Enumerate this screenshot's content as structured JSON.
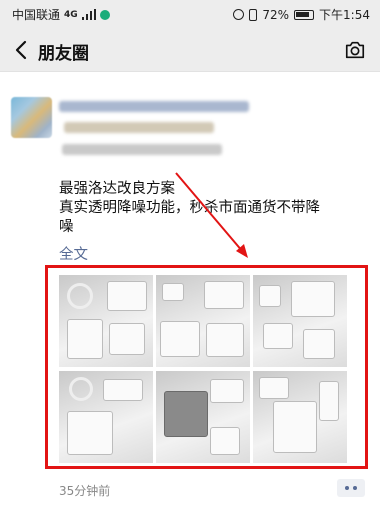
{
  "status_bar": {
    "carrier": "中国联通",
    "network": "4G",
    "battery": "72%",
    "time": "下午1:54",
    "icons": [
      "signal-icon",
      "wechat-status-icon",
      "alarm-icon",
      "vibrate-icon",
      "battery-icon"
    ]
  },
  "nav": {
    "title": "朋友圈",
    "back_icon": "chevron-left-icon",
    "camera_icon": "camera-icon"
  },
  "post": {
    "text_lines": [
      "最强洛达改良方案",
      "真实透明降噪功能，秒杀市面通货不带降",
      "噪"
    ],
    "full_text_link": "全文",
    "time": "35分钟前",
    "images": [
      {
        "label": "photo-1"
      },
      {
        "label": "photo-2"
      },
      {
        "label": "photo-3"
      },
      {
        "label": "photo-4"
      },
      {
        "label": "photo-5"
      },
      {
        "label": "photo-6"
      }
    ]
  },
  "colors": {
    "link": "#576b95",
    "highlight": "#e21414",
    "header_bg": "#ededed"
  }
}
